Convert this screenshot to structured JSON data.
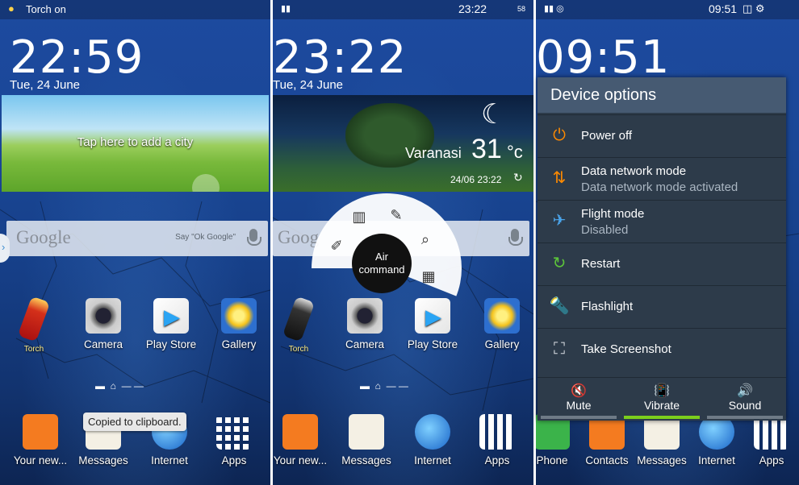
{
  "screen1": {
    "status": {
      "text": "Torch on"
    },
    "clock": "22:59",
    "date": "Tue, 24 June",
    "weather_prompt": "Tap here to add a city",
    "search": {
      "brand": "Google",
      "hint": "Say \"Ok Google\""
    },
    "apps": [
      {
        "label": "Torch",
        "icon": "torch-icon"
      },
      {
        "label": "Camera",
        "icon": "camera-icon"
      },
      {
        "label": "Play Store",
        "icon": "play-store-icon"
      },
      {
        "label": "Gallery",
        "icon": "gallery-icon"
      }
    ],
    "dock": [
      {
        "label": "Your new...",
        "icon": "contacts-icon"
      },
      {
        "label": "Messages",
        "icon": "messages-icon"
      },
      {
        "label": "Internet",
        "icon": "internet-icon"
      },
      {
        "label": "Apps",
        "icon": "apps-grid-icon"
      }
    ],
    "toast": "Copied to clipboard."
  },
  "screen2": {
    "status": {
      "clock": "23:22",
      "battery": "58"
    },
    "clock": "23:22",
    "date": "Tue, 24 June",
    "city": "Varanasi",
    "temperature": "31",
    "temp_unit": "°c",
    "updated": "24/06 23:22",
    "search": {
      "brand": "Goog"
    },
    "air_command": {
      "line1": "Air",
      "line2": "command"
    },
    "apps": [
      {
        "label": "Torch"
      },
      {
        "label": "Camera"
      },
      {
        "label": "Play Store"
      },
      {
        "label": "Gallery"
      }
    ],
    "dock": [
      {
        "label": "Your new..."
      },
      {
        "label": "Messages"
      },
      {
        "label": "Internet"
      },
      {
        "label": "Apps"
      }
    ]
  },
  "screen3": {
    "status": {
      "clock": "09:51"
    },
    "clock": "09:51",
    "device_options": {
      "title": "Device options",
      "items": [
        {
          "label": "Power off",
          "icon": "power-icon"
        },
        {
          "label": "Data network mode",
          "sub": "Data network mode activated",
          "icon": "data-network-icon"
        },
        {
          "label": "Flight mode",
          "sub": "Disabled",
          "icon": "airplane-icon"
        },
        {
          "label": "Restart",
          "icon": "restart-icon"
        },
        {
          "label": "Flashlight",
          "icon": "flashlight-icon"
        },
        {
          "label": "Take Screenshot",
          "icon": "screenshot-icon"
        }
      ],
      "sound_modes": [
        {
          "label": "Mute",
          "icon": "mute-icon",
          "active": false
        },
        {
          "label": "Vibrate",
          "icon": "vibrate-icon",
          "active": true
        },
        {
          "label": "Sound",
          "icon": "sound-icon",
          "active": false
        }
      ]
    },
    "dock": [
      {
        "label": "Phone"
      },
      {
        "label": "Contacts"
      },
      {
        "label": "Messages"
      },
      {
        "label": "Internet"
      },
      {
        "label": "Apps"
      }
    ]
  },
  "colors": {
    "accent_green": "#7ccf1c",
    "power_orange": "#ff8a00",
    "panel": "#2d3b4a",
    "title_bar": "#465a72"
  }
}
